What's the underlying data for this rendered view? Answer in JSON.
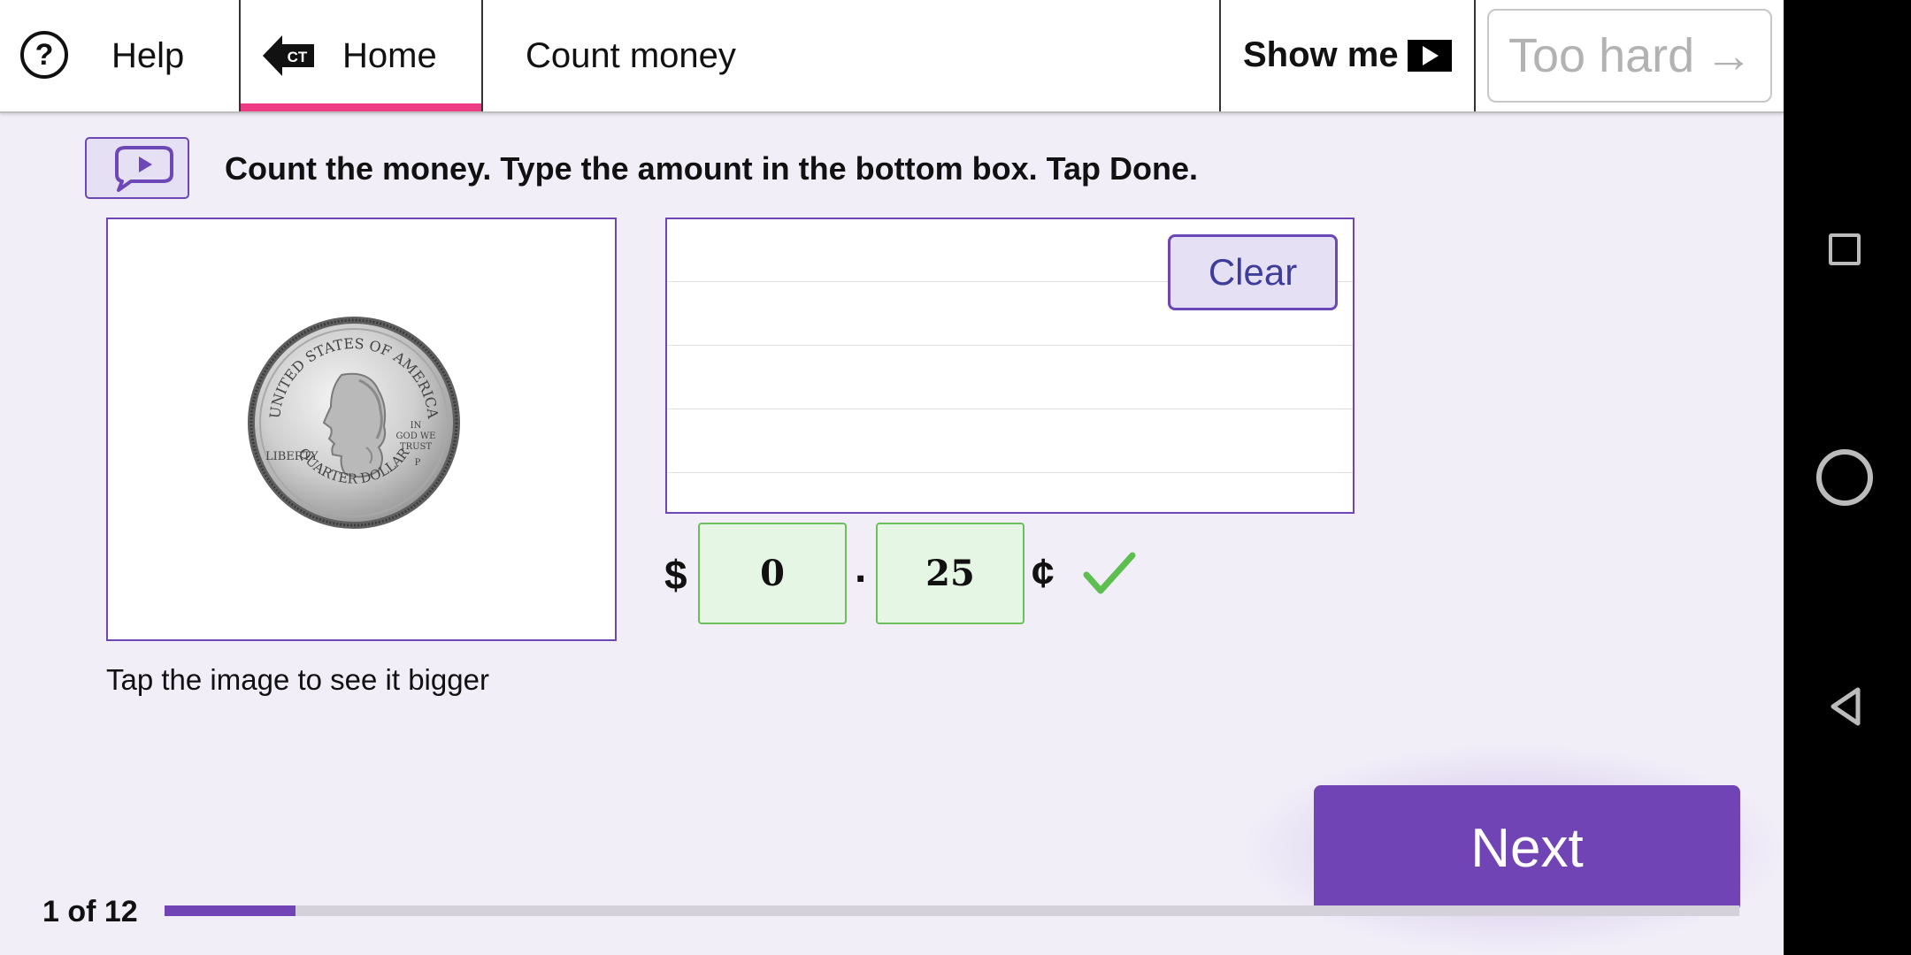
{
  "topbar": {
    "help_label": "Help",
    "help_glyph": "?",
    "home_label": "Home",
    "home_badge": "CT",
    "title": "Count money",
    "show_me_label": "Show me",
    "too_hard_label": "Too hard",
    "too_hard_arrow": "→",
    "accent_color": "#ee3b86"
  },
  "instruction": {
    "text": "Count the money. Type the amount in the bottom box. Tap Done.",
    "speak_icon": "speech-bubble-play-icon"
  },
  "image_panel": {
    "coin_top_text": "UNITED STATES OF AMERICA",
    "coin_left_text": "LIBERTY",
    "coin_motto": [
      "IN",
      "GOD WE",
      "TRUST"
    ],
    "coin_mint_mark": "P",
    "coin_bottom_text": "QUARTER DOLLAR",
    "hint": "Tap the image to see it bigger"
  },
  "pad": {
    "clear_label": "Clear"
  },
  "answer": {
    "dollar_symbol": "$",
    "dollars": "0",
    "separator": ".",
    "cents": "25",
    "cent_symbol": "¢",
    "status": "correct",
    "status_color": "#5cbf4f"
  },
  "next_label": "Next",
  "progress": {
    "label": "1 of 12",
    "current": 1,
    "total": 12,
    "fill_color": "#7144b6"
  },
  "colors": {
    "page_bg": "#f1eef8",
    "purple": "#7144b6",
    "border_purple": "#6e47b6"
  }
}
